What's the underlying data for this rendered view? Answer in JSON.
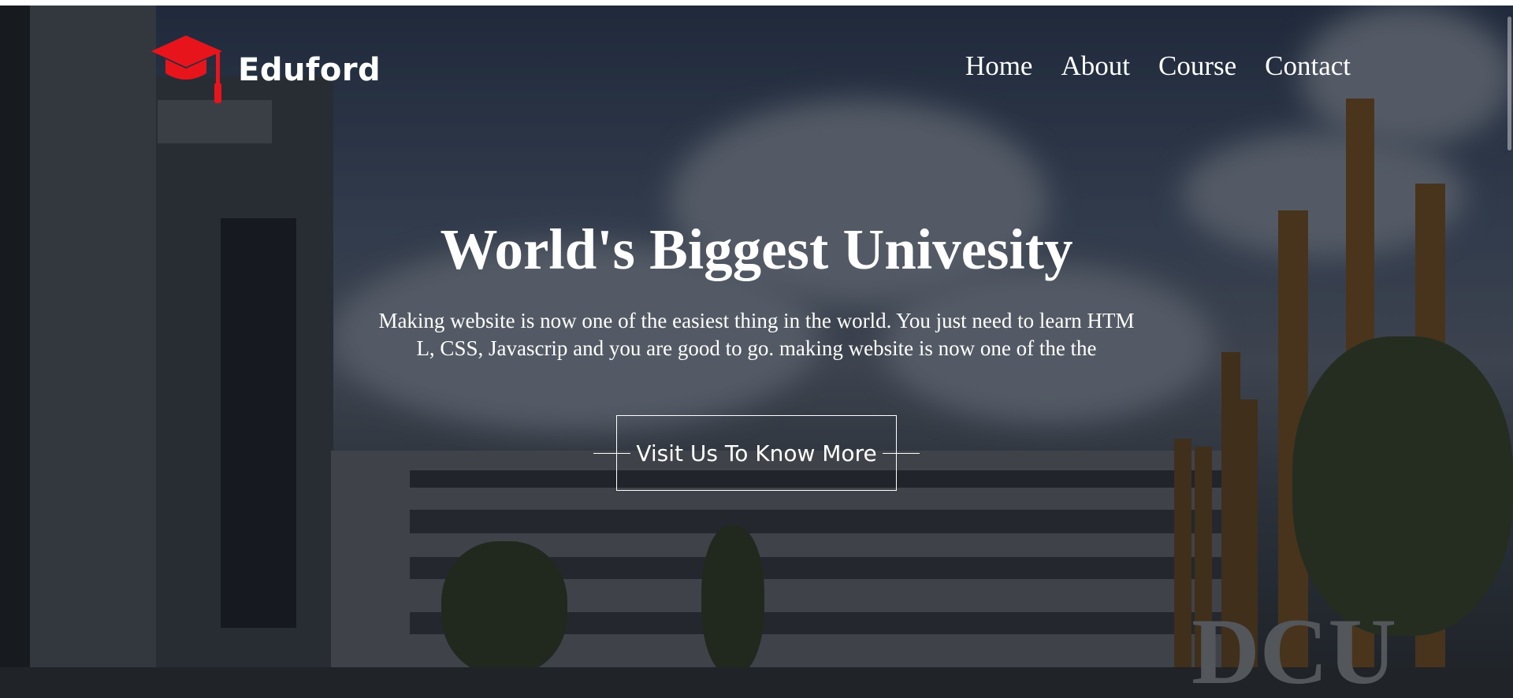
{
  "brand": {
    "name": "Eduford",
    "accent": "#e8141c"
  },
  "nav": {
    "items": [
      "Home",
      "About",
      "Course",
      "Contact"
    ]
  },
  "hero": {
    "title": "World's Biggest Univesity",
    "description": "Making website is now one of the easiest thing in the world. You just need to learn HTML, CSS, Javascrip and you are good to go. making website is now one of the the",
    "cta_label": "Visit Us To Know More"
  },
  "background": {
    "sign_text": "DCU"
  }
}
